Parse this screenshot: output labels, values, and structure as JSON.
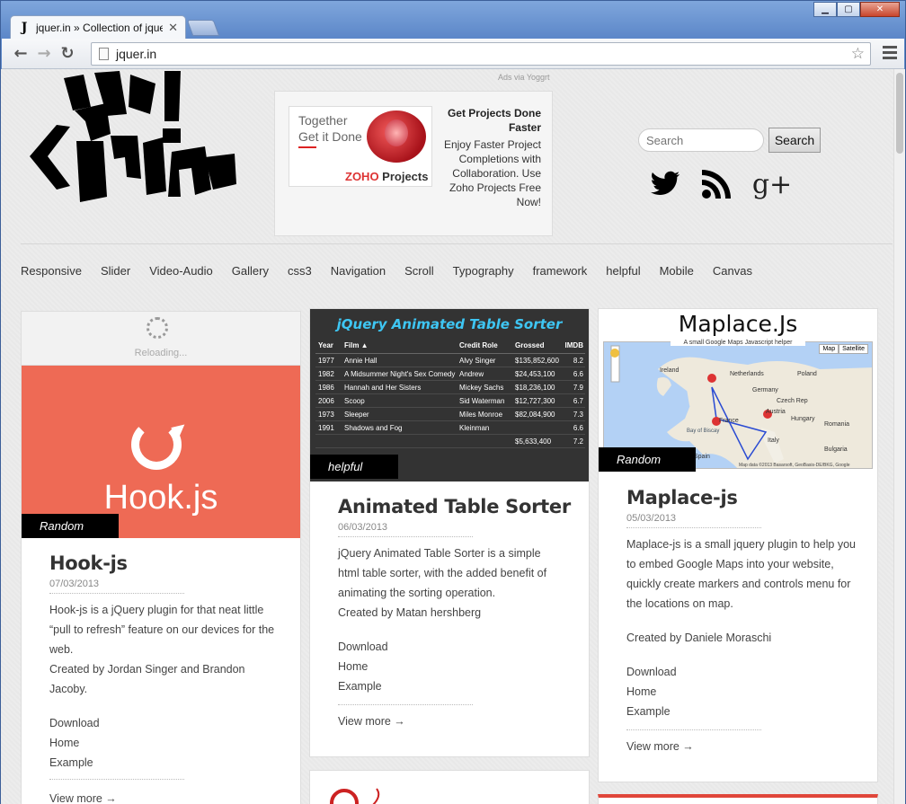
{
  "browser": {
    "tab_title": "jquer.in » Collection of jquer",
    "tab_favicon": "J",
    "url": "jquer.in",
    "window_buttons": [
      "▁",
      "▢",
      "✕"
    ]
  },
  "header": {
    "ads_via": "Ads via Yoggrt",
    "ad": {
      "image_line1": "Together",
      "image_line2": "Get it Done",
      "image_brand_prefix": "ZOHO",
      "image_brand_suffix": " Projects",
      "headline": "Get Projects Done Faster",
      "body": "Enjoy Faster Project Completions with Collaboration. Use Zoho Projects Free Now!"
    },
    "search_placeholder": "Search",
    "search_button": "Search",
    "social": [
      "twitter-icon",
      "rss-icon",
      "google-plus-icon"
    ]
  },
  "nav": [
    "Responsive",
    "Slider",
    "Video-Audio",
    "Gallery",
    "css3",
    "Navigation",
    "Scroll",
    "Typography",
    "framework",
    "helpful",
    "Mobile",
    "Canvas"
  ],
  "cards": [
    {
      "thumb_reload_text": "Reloading...",
      "thumb_title": "Hook.js",
      "category": "Random",
      "title": "Hook-js",
      "date": "07/03/2013",
      "desc": "Hook-js is a jQuery plugin for that neat little “pull to refresh” feature on our devices for the web.",
      "credit": "Created by Jordan Singer and Brandon Jacoby.",
      "links": [
        "Download",
        "Home",
        "Example"
      ],
      "more": "View more →"
    },
    {
      "thumb_title": "jQuery Animated Table Sorter",
      "thumb_headers": [
        "Year",
        "Film ▲",
        "Credit Role",
        "Grossed",
        "IMDB"
      ],
      "thumb_rows": [
        [
          "1977",
          "Annie Hall",
          "Alvy Singer",
          "$135,852,600",
          "8.2"
        ],
        [
          "1982",
          "A Midsummer Night's Sex Comedy",
          "Andrew",
          "$24,453,100",
          "6.6"
        ],
        [
          "1986",
          "Hannah and Her Sisters",
          "Mickey Sachs",
          "$18,236,100",
          "7.9"
        ],
        [
          "2006",
          "Scoop",
          "Sid Waterman",
          "$12,727,300",
          "6.7"
        ],
        [
          "1973",
          "Sleeper",
          "Miles Monroe",
          "$82,084,900",
          "7.3"
        ],
        [
          "1991",
          "Shadows and Fog",
          "Kleinman",
          "",
          "6.6"
        ],
        [
          "",
          "",
          "",
          "$5,633,400",
          "7.2"
        ]
      ],
      "category": "helpful",
      "title": "Animated Table Sorter",
      "date": "06/03/2013",
      "desc": "jQuery Animated Table Sorter is a simple html table sorter, with the added benefit of animating the sorting operation.",
      "credit": "Created by Matan hershberg",
      "links": [
        "Download",
        "Home",
        "Example"
      ],
      "more": "View more →"
    },
    {
      "thumb_title": "Maplace.Js",
      "thumb_subtitle": "A small Google Maps Javascript helper",
      "map_buttons": [
        "Map",
        "Satellite"
      ],
      "map_labels": [
        "Ireland",
        "Netherlands",
        "Poland",
        "Germany",
        "Czech Rep",
        "France",
        "Austria",
        "Hungary",
        "Romania",
        "Italy",
        "Bulgaria",
        "Spain",
        "Bay of Biscay"
      ],
      "map_credit": "Map data ©2013 Basarsoft, GeoBasis-DE/BKG, Google",
      "category": "Random",
      "title": "Maplace-js",
      "date": "05/03/2013",
      "desc": "Maplace-js is a small jquery plugin to help you to embed Google Maps into your website, quickly create markers and controls menu for the locations on map.",
      "credit": "Created by Daniele Moraschi",
      "links": [
        "Download",
        "Home",
        "Example"
      ],
      "more": "View more →"
    }
  ],
  "colors": {
    "hook_bg": "#ee6a55",
    "table_bg": "#333333",
    "table_title": "#3ec6f3",
    "badge_bg": "#000000",
    "window_frame": "#5d88c9"
  }
}
